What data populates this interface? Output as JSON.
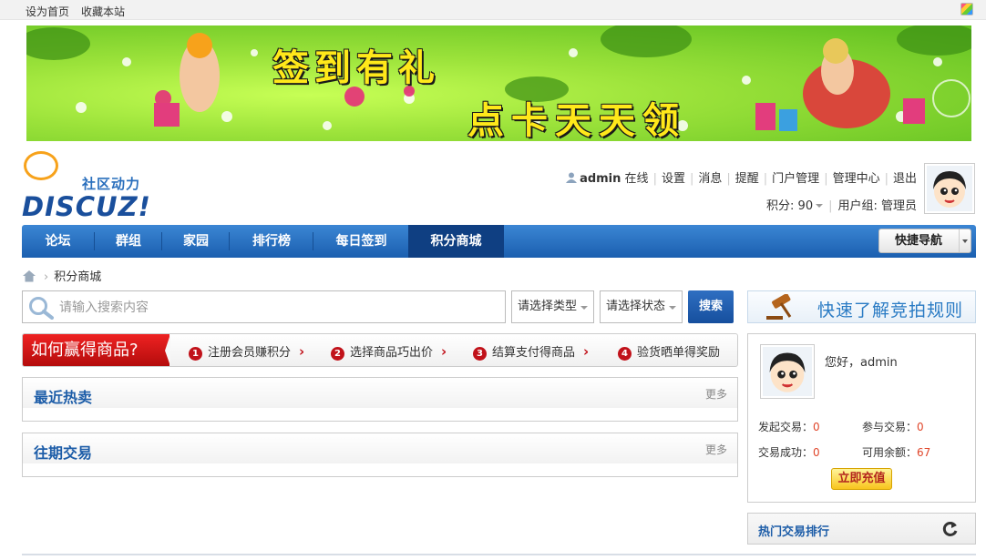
{
  "topbar": {
    "set_home": "设为首页",
    "bookmark": "收藏本站"
  },
  "banner": {
    "line1": "签到有礼",
    "line2": "点卡天天领"
  },
  "logo": {
    "tagline": "社区动力",
    "wordmark": "DISCUZ!"
  },
  "user": {
    "name": "admin",
    "online": "在线",
    "links": [
      "设置",
      "消息",
      "提醒",
      "门户管理",
      "管理中心",
      "退出"
    ],
    "points_label": "积分: 90",
    "group_label": "用户组: 管理员"
  },
  "nav": {
    "items": [
      "论坛",
      "群组",
      "家园",
      "排行榜",
      "每日签到",
      "积分商城"
    ],
    "active": "积分商城",
    "quick_nav": "快捷导航"
  },
  "breadcrumb": {
    "current": "积分商城"
  },
  "search": {
    "placeholder": "请输入搜索内容",
    "type_select": "请选择类型",
    "status_select": "请选择状态",
    "button": "搜索"
  },
  "steps": {
    "heading": "如何赢得商品?",
    "items": [
      {
        "num": "1",
        "label": "注册会员赚积分"
      },
      {
        "num": "2",
        "label": "选择商品巧出价"
      },
      {
        "num": "3",
        "label": "结算支付得商品"
      },
      {
        "num": "4",
        "label": "验货晒单得奖励"
      }
    ]
  },
  "panels": {
    "recent": {
      "title": "最近热卖",
      "more": "更多"
    },
    "past": {
      "title": "往期交易",
      "more": "更多"
    }
  },
  "sidebar": {
    "rules_banner": "快速了解竞拍规则",
    "greeting": "您好，admin",
    "stats": {
      "started_label": "发起交易：",
      "started_value": "0",
      "joined_label": "参与交易：",
      "joined_value": "0",
      "success_label": "交易成功：",
      "success_value": "0",
      "balance_label": "可用余额：",
      "balance_value": "67"
    },
    "recharge": "立即充值",
    "hot_rank": "热门交易排行"
  },
  "colors": {
    "nav_blue": "#1b5fb0",
    "accent_red": "#c1121a",
    "link_blue": "#1d5da8",
    "value_orange": "#e0462a"
  }
}
